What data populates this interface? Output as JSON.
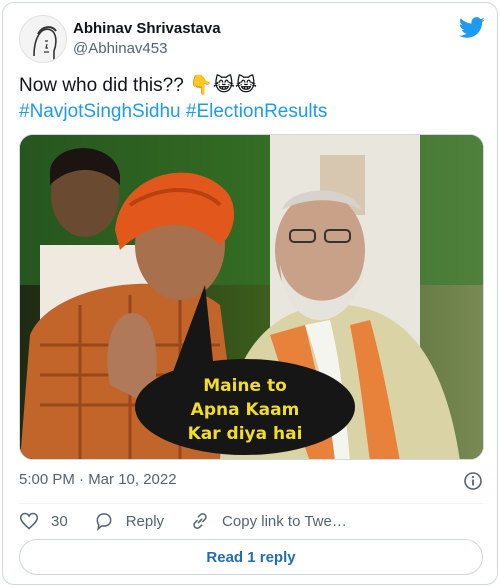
{
  "tweet": {
    "display_name": "Abhinav Shrivastava",
    "handle": "@Abhinav453",
    "text_line1": "Now who did this?? 👇😹😹",
    "hashtag1": "#NavjotSinghSidhu",
    "hashtag2": "#ElectionResults",
    "timestamp": "5:00 PM · Mar 10, 2022",
    "like_count": "30",
    "reply_label": "Reply",
    "copy_link_label": "Copy link to Twe…",
    "read_replies_label": "Read 1 reply"
  },
  "media": {
    "bubble_line1": "Maine to",
    "bubble_line2": "Apna Kaam",
    "bubble_line3": "Kar diya hai"
  },
  "colors": {
    "accent": "#1d9bf0",
    "text_secondary": "#536471",
    "border": "#cfd9de",
    "bubble_text": "#f2dc2a"
  },
  "icons": {
    "brand": "twitter-bird-icon",
    "info": "info-icon",
    "like": "heart-icon",
    "reply": "reply-bubble-icon",
    "copy_link": "link-icon"
  }
}
